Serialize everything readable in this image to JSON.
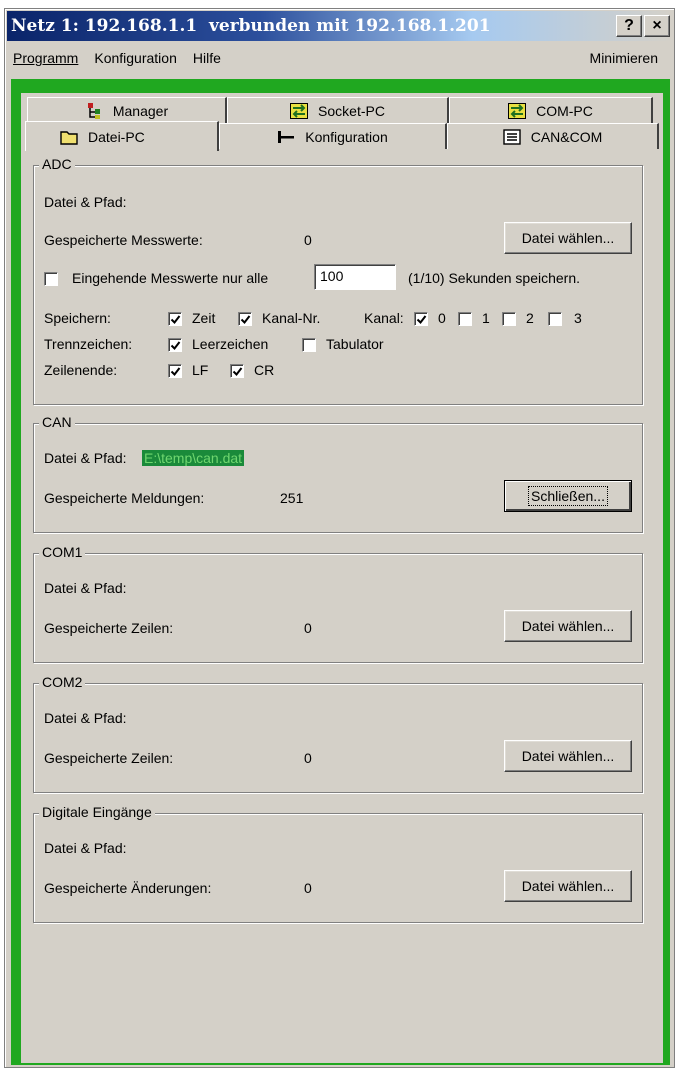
{
  "window": {
    "title": "Netz 1: 192.168.1.1  verbunden mit 192.168.1.201",
    "help_button": "?",
    "close_button": "×"
  },
  "menu": {
    "items": [
      {
        "label": "Programm"
      },
      {
        "label": "Konfiguration"
      },
      {
        "label": "Hilfe"
      }
    ],
    "minimize": "Minimieren"
  },
  "tabs": {
    "row_back": [
      {
        "label": "Manager",
        "icon": "manager-tree-icon"
      },
      {
        "label": "Socket-PC",
        "icon": "exchange-arrows-icon"
      },
      {
        "label": "COM-PC",
        "icon": "exchange-arrows-icon"
      }
    ],
    "row_front": [
      {
        "label": "Datei-PC",
        "icon": "folder-icon",
        "active": true
      },
      {
        "label": "Konfiguration",
        "icon": "connector-icon"
      },
      {
        "label": "CAN&COM",
        "icon": "list-icon"
      }
    ]
  },
  "adc": {
    "title": "ADC",
    "path_label": "Datei & Pfad:",
    "saved_label": "Gespeicherte Messwerte:",
    "saved_value": "0",
    "choose_button": "Datei wählen...",
    "interval_check": false,
    "interval_label_before": "Eingehende Messwerte nur alle",
    "interval_value": "100",
    "interval_label_after": "(1/10) Sekunden speichern.",
    "speichern_label": "Speichern:",
    "zeit_label": "Zeit",
    "zeit_checked": true,
    "kanalnr_label": "Kanal-Nr.",
    "kanalnr_checked": true,
    "kanal_label": "Kanal:",
    "channels": [
      {
        "label": "0",
        "checked": true
      },
      {
        "label": "1",
        "checked": false
      },
      {
        "label": "2",
        "checked": false
      },
      {
        "label": "3",
        "checked": false
      }
    ],
    "trenn_label": "Trennzeichen:",
    "leerzeichen_label": "Leerzeichen",
    "leerzeichen_checked": true,
    "tabulator_label": "Tabulator",
    "tabulator_checked": false,
    "zeilenende_label": "Zeilenende:",
    "lf_label": "LF",
    "lf_checked": true,
    "cr_label": "CR",
    "cr_checked": true
  },
  "can": {
    "title": "CAN",
    "path_label": "Datei & Pfad:",
    "path_value": "E:\\temp\\can.dat",
    "saved_label": "Gespeicherte Meldungen:",
    "saved_value": "251",
    "close_button": "Schließen..."
  },
  "com1": {
    "title": "COM1",
    "path_label": "Datei & Pfad:",
    "saved_label": "Gespeicherte Zeilen:",
    "saved_value": "0",
    "choose_button": "Datei wählen..."
  },
  "com2": {
    "title": "COM2",
    "path_label": "Datei & Pfad:",
    "saved_label": "Gespeicherte Zeilen:",
    "saved_value": "0",
    "choose_button": "Datei wählen..."
  },
  "digital": {
    "title": "Digitale Eingänge",
    "path_label": "Datei & Pfad:",
    "saved_label": "Gespeicherte Änderungen:",
    "saved_value": "0",
    "choose_button": "Datei wählen..."
  },
  "colors": {
    "title_bar_start": "#0a246a",
    "green_frame": "#20a820",
    "panel_face": "#d4d0c8",
    "path_highlight": "#1a8a3a"
  }
}
